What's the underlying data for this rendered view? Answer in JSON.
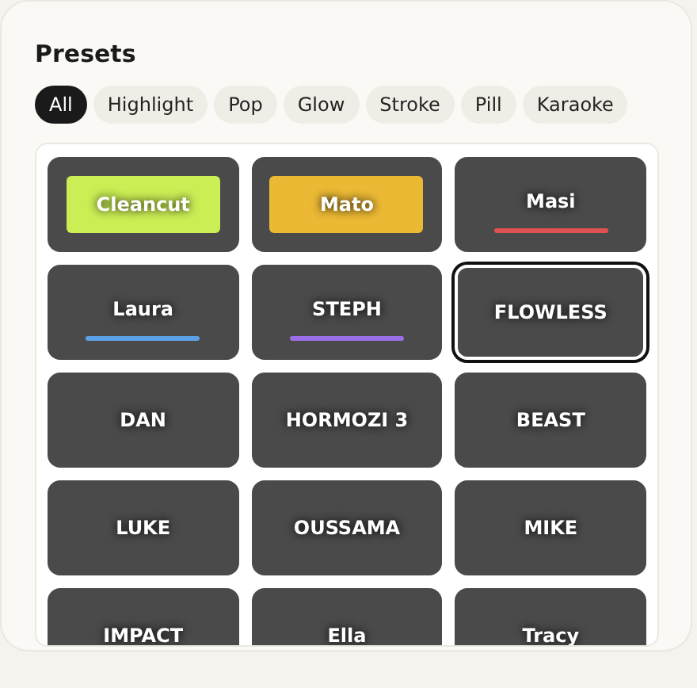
{
  "title": "Presets",
  "filters": [
    {
      "label": "All",
      "selected": true
    },
    {
      "label": "Highlight",
      "selected": false
    },
    {
      "label": "Pop",
      "selected": false
    },
    {
      "label": "Glow",
      "selected": false
    },
    {
      "label": "Stroke",
      "selected": false
    },
    {
      "label": "Pill",
      "selected": false
    },
    {
      "label": "Karaoke",
      "selected": false
    }
  ],
  "presets": [
    {
      "label": "Cleancut",
      "kind": "fill",
      "color": "#cbee55",
      "selected": false
    },
    {
      "label": "Mato",
      "kind": "fill",
      "color": "#ebb934",
      "selected": false
    },
    {
      "label": "Masi",
      "kind": "underline",
      "color": "#e05252",
      "selected": false
    },
    {
      "label": "Laura",
      "kind": "underline",
      "color": "#5aa1e8",
      "selected": false
    },
    {
      "label": "STEPH",
      "kind": "underline",
      "color": "#9a6ee8",
      "selected": false
    },
    {
      "label": "FLOWLESS",
      "kind": "plain",
      "selected": true
    },
    {
      "label": "DAN",
      "kind": "plain",
      "selected": false
    },
    {
      "label": "HORMOZI 3",
      "kind": "plain",
      "selected": false
    },
    {
      "label": "BEAST",
      "kind": "plain",
      "selected": false
    },
    {
      "label": "LUKE",
      "kind": "plain",
      "selected": false
    },
    {
      "label": "OUSSAMA",
      "kind": "plain",
      "selected": false
    },
    {
      "label": "MIKE",
      "kind": "plain",
      "selected": false
    },
    {
      "label": "IMPACT",
      "kind": "plain",
      "selected": false
    },
    {
      "label": "Ella",
      "kind": "plain",
      "selected": false
    },
    {
      "label": "Tracy",
      "kind": "plain",
      "selected": false
    }
  ]
}
